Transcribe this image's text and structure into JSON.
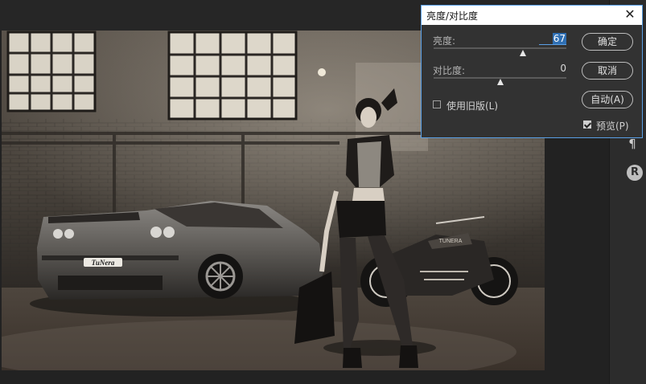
{
  "dialog": {
    "title": "亮度/对比度",
    "brightness": {
      "label": "亮度:",
      "value": "67",
      "level": 0.67
    },
    "contrast": {
      "label": "对比度:",
      "value": "0",
      "level": 0.5
    },
    "legacy": {
      "label": "使用旧版(L)",
      "checked": false
    },
    "preview": {
      "label": "预览(P)",
      "checked": true
    },
    "buttons": {
      "ok": "确定",
      "cancel": "取消",
      "auto": "自动(A)"
    }
  },
  "photo": {
    "plate_text": "TuNera",
    "tank_text": "TUNERA"
  },
  "panel": {
    "icons": [
      "pilcrow-icon",
      "glyph-icon"
    ],
    "pilcrow_glyph": "¶",
    "glyph_char": "R"
  },
  "colors": {
    "accent": "#5aa0e6",
    "dialog_bg": "#323232"
  }
}
